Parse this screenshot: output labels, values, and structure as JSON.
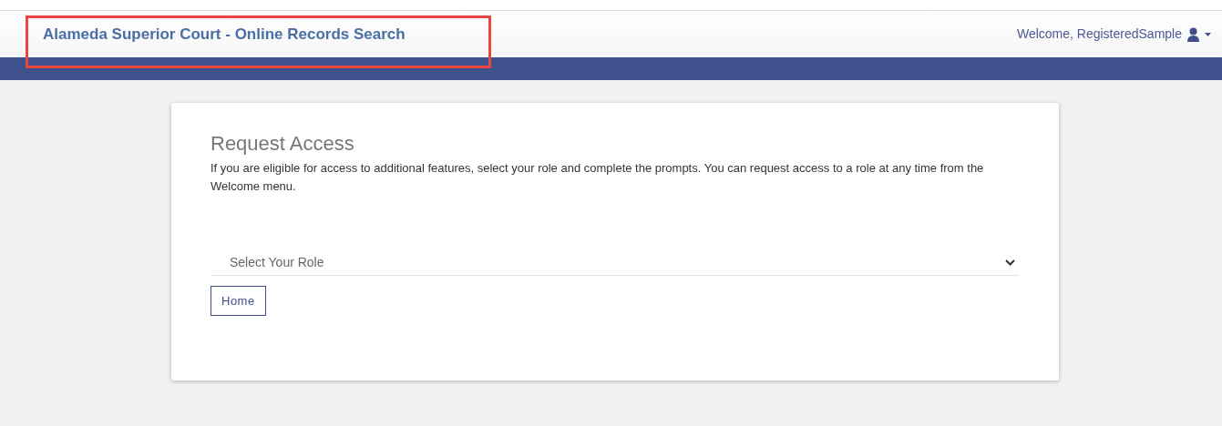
{
  "header": {
    "title": "Alameda Superior Court - Online Records Search",
    "welcome": "Welcome, RegisteredSample",
    "highlighted": true
  },
  "card": {
    "title": "Request Access",
    "description": "If you are eligible for access to additional features, select your role and complete the prompts. You can request access to a role at any time from the Welcome menu.",
    "role_select": {
      "placeholder": "Select Your Role"
    },
    "buttons": [
      "Home"
    ]
  }
}
